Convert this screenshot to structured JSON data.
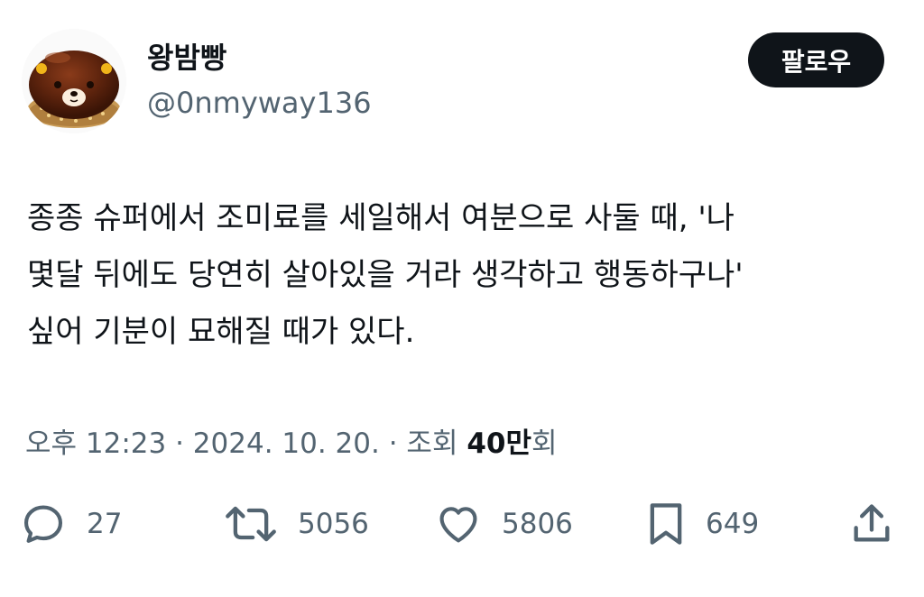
{
  "author": {
    "display_name": "왕밤빵",
    "handle": "@0nmyway136"
  },
  "follow_button": {
    "label": "팔로우"
  },
  "tweet": {
    "lines": [
      "종종 슈퍼에서 조미료를 세일해서 여분으로 사둘 때, '나",
      "몇달 뒤에도 당연히 살아있을 거라 생각하고 행동하구나'",
      "싶어 기분이 묘해질 때가 있다."
    ]
  },
  "meta": {
    "time": "오후 12:23",
    "separator": " · ",
    "date": "2024. 10. 20.",
    "views_label": "조회",
    "views_count": "40만",
    "views_suffix": "회"
  },
  "actions": {
    "reply_count": "27",
    "retweet_count": "5056",
    "like_count": "5806",
    "bookmark_count": "649"
  },
  "colors": {
    "text_primary": "#0f1419",
    "text_secondary": "#536471",
    "button_bg": "#0f1419"
  }
}
